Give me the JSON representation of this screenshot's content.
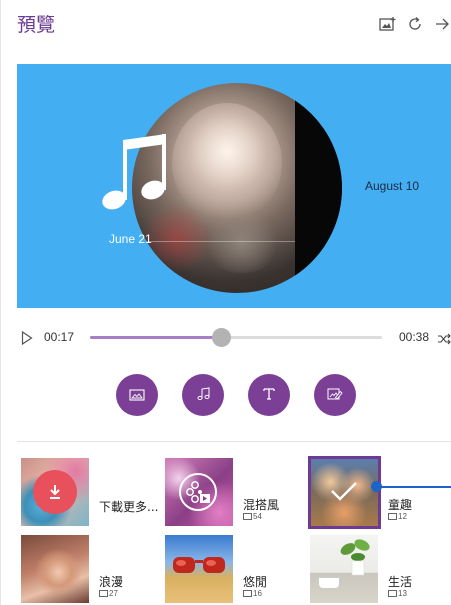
{
  "header": {
    "title": "預覽",
    "icons": [
      "add-photo-icon",
      "refresh-icon",
      "forward-arrow-icon"
    ]
  },
  "preview": {
    "date_left": "June 21",
    "date_right": "August 10",
    "music_icon": "music-note-icon"
  },
  "playback": {
    "current_time": "00:17",
    "total_time": "00:38",
    "progress": 0.45,
    "play_icon": "play-icon",
    "shuffle_icon": "shuffle-icon"
  },
  "actions": [
    {
      "name": "image-button",
      "icon": "image-icon"
    },
    {
      "name": "music-button",
      "icon": "music-icon"
    },
    {
      "name": "text-button",
      "icon": "text-icon"
    },
    {
      "name": "edit-media-button",
      "icon": "edit-media-icon"
    }
  ],
  "themes": [
    {
      "label": "下載更多...",
      "count": ""
    },
    {
      "label": "混搭風",
      "count": "54"
    },
    {
      "label": "童趣",
      "count": "12",
      "selected": true
    },
    {
      "label": "浪漫",
      "count": "27"
    },
    {
      "label": "悠閒",
      "count": "16"
    },
    {
      "label": "生活",
      "count": "13"
    }
  ],
  "colors": {
    "accent": "#7b3f96",
    "preview_bg": "#44aef2",
    "download_red": "#e8505b",
    "selection_blue": "#1f62c8"
  }
}
